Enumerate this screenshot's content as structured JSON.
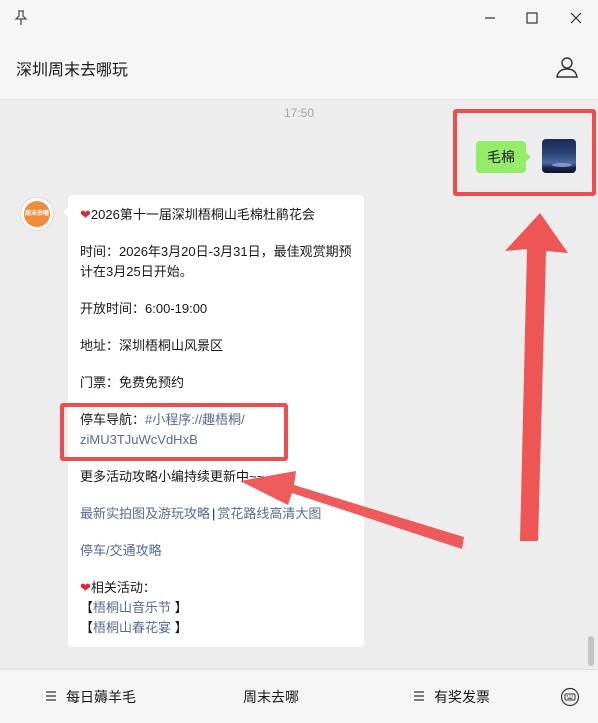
{
  "window": {
    "pin_icon": "pin-icon",
    "minimize_icon": "minimize-icon",
    "maximize_icon": "maximize-icon",
    "close_icon": "close-icon"
  },
  "header": {
    "title": "深圳周末去哪玩",
    "profile_icon": "person-icon"
  },
  "chat": {
    "timestamp": "17:50",
    "outgoing": {
      "text": "毛棉"
    },
    "incoming": {
      "title": "2026第十一届深圳梧桐山毛棉杜鹃花会",
      "time_label": "时间：2026年3月20日-3月31日，最佳观赏期预",
      "time_label_2": "计在3月25日开始。",
      "open_hours": "开放时间：6:00-19:00",
      "address": "地址：深圳梧桐山风景区",
      "ticket": "门票：免费免预约",
      "parking_label": "停车导航：",
      "parking_link_1": "#小程序://趣梧桐/",
      "parking_link_2": "ziMU3TJuWcVdHxB",
      "more": "更多活动攻略小编持续更新中~~",
      "link_photos": "最新实拍图及游玩攻略",
      "separator": "|",
      "link_route": "赏花路线高清大图",
      "link_traffic": "停车/交通攻略",
      "related_title": "相关活动：",
      "related_1_open": "【",
      "related_1": "梧桐山音乐节",
      "related_1_close": "】",
      "related_2_open": "【",
      "related_2": "梧桐山春花宴",
      "related_2_close": "】"
    },
    "avatar_text": "周末去哪"
  },
  "bottom_menu": {
    "items": [
      {
        "label": "每日薅羊毛"
      },
      {
        "label": "周末去哪"
      },
      {
        "label": "有奖发票"
      }
    ],
    "keyboard_icon": "keyboard-icon"
  },
  "colors": {
    "accent_green": "#95ec69",
    "link_blue": "#576b95",
    "annotation_red": "#ee4d4d"
  }
}
